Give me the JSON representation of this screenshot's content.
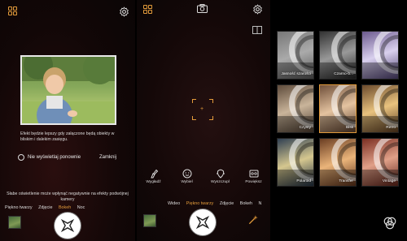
{
  "left": {
    "dialog_message": "Efekt będzie lepszy gdy załączone będą obiekty w bliskim i dalekim zasięgu.",
    "dont_show_again": "Nie wyświetlaj ponownie",
    "close": "Zamknij",
    "warning": "Słabe oświetlenie może wpłynąć negatywnie na efekty podwójnej kamery",
    "modes": [
      "Piękno twarzy",
      "Zdjęcie",
      "Bokeh",
      "Noc"
    ],
    "active_mode": "Bokeh"
  },
  "middle": {
    "bokeh_options": [
      "Wygładź",
      "Wybiel",
      "Wyszczupl",
      "Powiększ"
    ],
    "modes": [
      "Wideo",
      "Piękno twarzy",
      "Zdjęcie",
      "Bokeh",
      "N"
    ],
    "active_mode": "Piękno twarzy"
  },
  "right": {
    "filters": [
      {
        "label": "Jasność szarości",
        "tone": "gray"
      },
      {
        "label": "Czarno-b...",
        "tone": "bw"
      },
      {
        "label": "",
        "tone": "violet"
      },
      {
        "label": "Czysty",
        "tone": "clean"
      },
      {
        "label": "Bisk",
        "tone": "bisk"
      },
      {
        "label": "Retro",
        "tone": "retro"
      },
      {
        "label": "Polaroid",
        "tone": "polaroid"
      },
      {
        "label": "Transfer",
        "tone": "transfer"
      },
      {
        "label": "Vintage",
        "tone": "vintage"
      }
    ]
  },
  "colors": {
    "accent": "#e39b3b"
  }
}
